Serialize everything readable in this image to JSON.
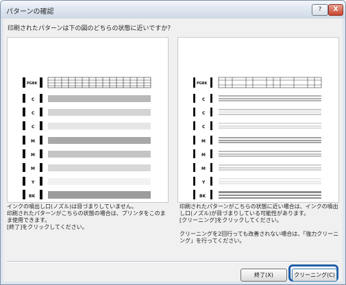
{
  "window": {
    "title": "パターンの確認",
    "help_label": "?",
    "close_label": "X"
  },
  "question": "印刷されたパターンは下の図のどちらの状態に近いですか？",
  "left_panel": {
    "labels": [
      "PGBK",
      "C",
      "C",
      "C",
      "M",
      "M",
      "M",
      "Y",
      "BK"
    ],
    "description": "インクの噴出し口(ノズル)は目づまりしていません。\n印刷されたパターンがこちらの状態の場合は、プリンタをこのまま使用できます。\n[終了]をクリックしてください。"
  },
  "right_panel": {
    "labels": [
      "PGBK",
      "C",
      "C",
      "C",
      "M",
      "M",
      "M",
      "Y",
      "BK"
    ],
    "description": "印刷されたパターンがこちらの状態に近い場合は、インクの噴出し口(ノズル)が目づまりしている可能性があります。\n[クリーニング]をクリックしてください。\n\nクリーニングを2回行っても改善されない場合は、「強力クリーニング」を行ってください。"
  },
  "buttons": {
    "end": "終了(X)",
    "cleaning": "クリーニング(C)"
  },
  "colors": {
    "accent": "#1f5ea8",
    "pattern_dark": "#111111",
    "bar_gray": "#b8b8b8"
  }
}
